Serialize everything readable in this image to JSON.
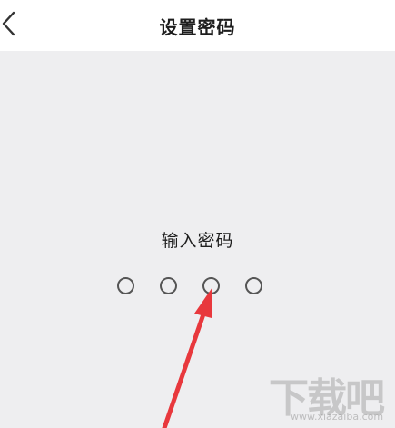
{
  "nav": {
    "title": "设置密码",
    "back_icon": "chevron-left-icon"
  },
  "main": {
    "prompt": "输入密码",
    "pin_length": 4,
    "pin_filled": 0
  },
  "watermark": {
    "text": "下载吧",
    "url": "www.xiazaiba.com"
  },
  "colors": {
    "background": "#eeeef0",
    "nav_background": "#ffffff",
    "annotation_arrow": "#e8383d"
  }
}
